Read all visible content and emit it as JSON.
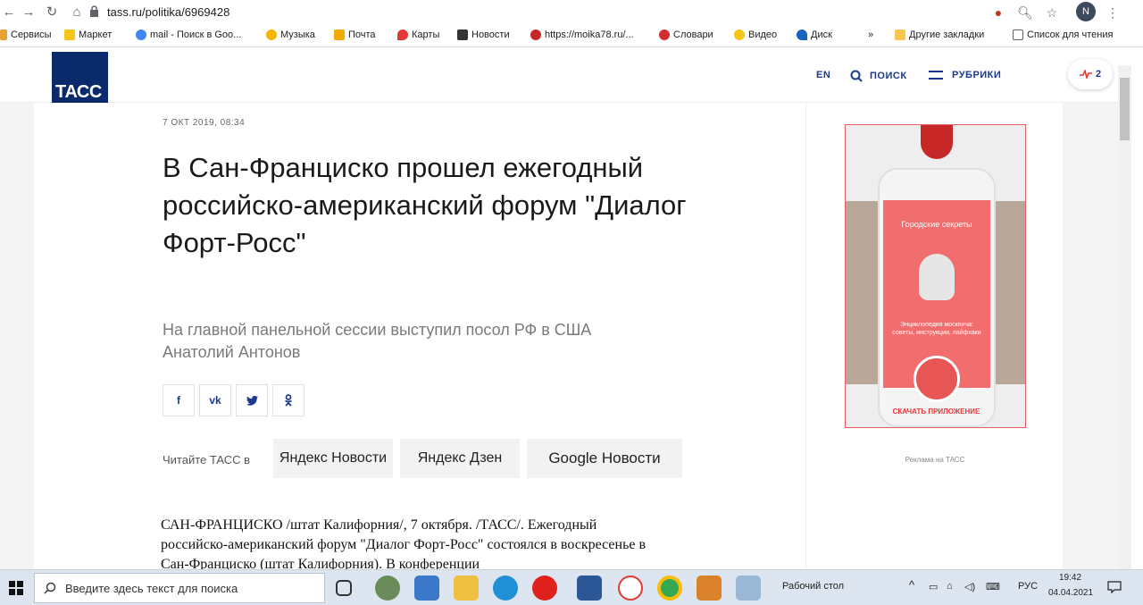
{
  "browser": {
    "url": "tass.ru/politika/6969428",
    "avatar_letter": "N",
    "bookmarks": [
      "Сервисы",
      "Маркет",
      "mail - Поиск в Goo...",
      "Музыка",
      "Почта",
      "Карты",
      "Новости",
      "https://moika78.ru/...",
      "Словари",
      "Видео",
      "Диск",
      "»",
      "Другие закладки",
      "Список для чтения"
    ]
  },
  "header": {
    "logo": "ТАСС",
    "lang": "EN",
    "search": "ПОИСК",
    "rubrics": "РУБРИКИ",
    "trend_count": "2"
  },
  "article": {
    "date": "7 ОКТ 2019, 08:34",
    "title": "В Сан-Франциско прошел ежегодный российско-американский форум \"Диалог Форт-Росс\"",
    "lead": "На главной панельной сессии выступил посол РФ в США Анатолий Антонов",
    "share": [
      "f",
      "vk",
      "tw",
      "ok"
    ],
    "read_in": "Читайте ТАСС в",
    "news_sources": [
      "Яндекс Новости",
      "Яндекс Дзен",
      "Google Новости"
    ],
    "body": "САН-ФРАНЦИСКО /штат Калифорния/, 7 октября. /ТАСС/. Ежегодный российско-американский форум \"Диалог Форт-Росс\" состоялся в воскресенье в Сан-Франциско (штат Калифорния). В конференции"
  },
  "sidebar": {
    "ad_title": "Городские секреты",
    "ad_sub": "Энциклопедия москвича: советы, инструкции, лайфхаки",
    "ad_button": "СКАЧАТЬ ПРИЛОЖЕНИЕ",
    "ad_caption": "Реклама на ТАСС"
  },
  "taskbar": {
    "search_placeholder": "Введите здесь текст для поиска",
    "desktop": "Рабочий стол",
    "lang": "РУС",
    "time": "19:42",
    "date": "04.04.2021"
  }
}
